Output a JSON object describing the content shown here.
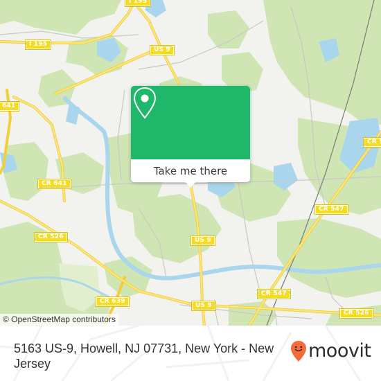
{
  "map": {
    "road_labels": [
      {
        "id": "i195-top",
        "text": "I 195"
      },
      {
        "id": "i195",
        "text": "I 195"
      },
      {
        "id": "us9-top",
        "text": "US 9"
      },
      {
        "id": "cr641-left",
        "text": "641"
      },
      {
        "id": "cr641",
        "text": "CR 641"
      },
      {
        "id": "cr526-left",
        "text": "CR 526"
      },
      {
        "id": "us9-mid",
        "text": "US 9"
      },
      {
        "id": "cr639",
        "text": "CR 639"
      },
      {
        "id": "us9-bottom",
        "text": "US 9"
      },
      {
        "id": "cr547-bottom",
        "text": "CR 547"
      },
      {
        "id": "cr547-right",
        "text": "CR 547"
      },
      {
        "id": "cr5-right",
        "text": "CR 5"
      },
      {
        "id": "cr526-right",
        "text": "CR 526"
      }
    ],
    "colors": {
      "land": "#f2f2ef",
      "forest": "#cfe6b4",
      "water": "#a9d6ec",
      "road_major": "#f7dc4a",
      "road_minor": "#c8c8c8",
      "rail": "#777777"
    }
  },
  "popup": {
    "icon": "map-pin-icon",
    "button_label": "Take me there",
    "accent_color": "#1fb76a"
  },
  "attribution": "© OpenStreetMap contributors",
  "footer": {
    "address": "5163 US-9, Howell, NJ 07731, New York - New Jersey",
    "logo_text": "moovit",
    "logo_color": "#f26b3a"
  }
}
